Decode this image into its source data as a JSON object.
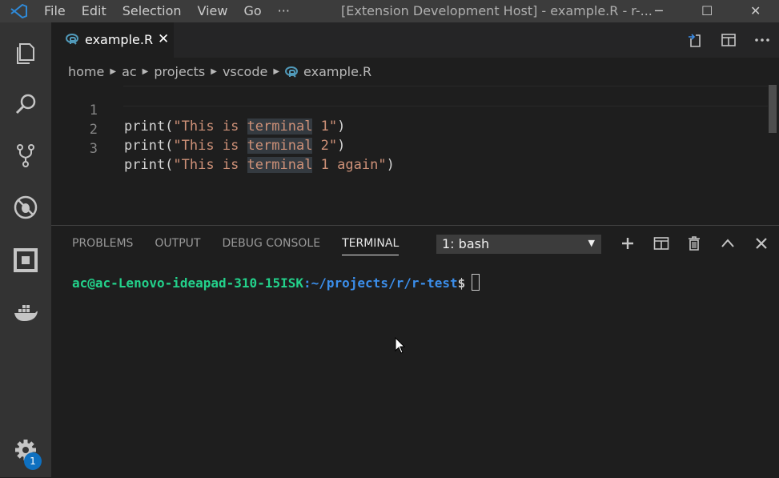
{
  "menu": [
    "File",
    "Edit",
    "Selection",
    "View",
    "Go",
    "···"
  ],
  "window_title": "[Extension Development Host] - example.R - r-...",
  "window_controls": {
    "minimize": "─",
    "maximize": "☐",
    "close": "✕"
  },
  "tab": {
    "label": "example.R",
    "close": "✕"
  },
  "tab_actions": [
    "open-changes-icon",
    "split-editor-icon",
    "more-actions-icon"
  ],
  "breadcrumb": [
    "home",
    "ac",
    "projects",
    "vscode",
    "example.R"
  ],
  "editor": {
    "lines": [
      {
        "num": "1",
        "pre": "print(",
        "s1": "\"This is ",
        "hl": "terminal",
        "s2": " 1\"",
        "post": ")"
      },
      {
        "num": "2",
        "pre": "print(",
        "s1": "\"This is ",
        "hl": "terminal",
        "s2": " 2\"",
        "post": ")"
      },
      {
        "num": "3",
        "pre": "print(",
        "s1": "\"This is ",
        "hl": "terminal",
        "s2": " 1 again\"",
        "post": ")"
      }
    ]
  },
  "panel": {
    "tabs": [
      "PROBLEMS",
      "OUTPUT",
      "DEBUG CONSOLE",
      "TERMINAL"
    ],
    "active_tab": "TERMINAL",
    "terminal_select": "1: bash",
    "actions": [
      "add-terminal-icon",
      "split-terminal-icon",
      "trash-icon",
      "maximize-panel-icon",
      "close-panel-icon"
    ]
  },
  "terminal": {
    "user_host": "ac@ac-Lenovo-ideapad-310-15ISK",
    "path": ":~/projects/r/r-test",
    "prompt": "$"
  },
  "activity_bar": {
    "icons": [
      "explorer-icon",
      "search-icon",
      "source-control-icon",
      "debug-icon",
      "extensions-icon",
      "docker-icon"
    ],
    "settings_badge": "1"
  },
  "colors": {
    "accent": "#0e70c0",
    "string": "#ce9178",
    "terminal_user": "#23d18b",
    "terminal_path": "#3b8eea"
  }
}
